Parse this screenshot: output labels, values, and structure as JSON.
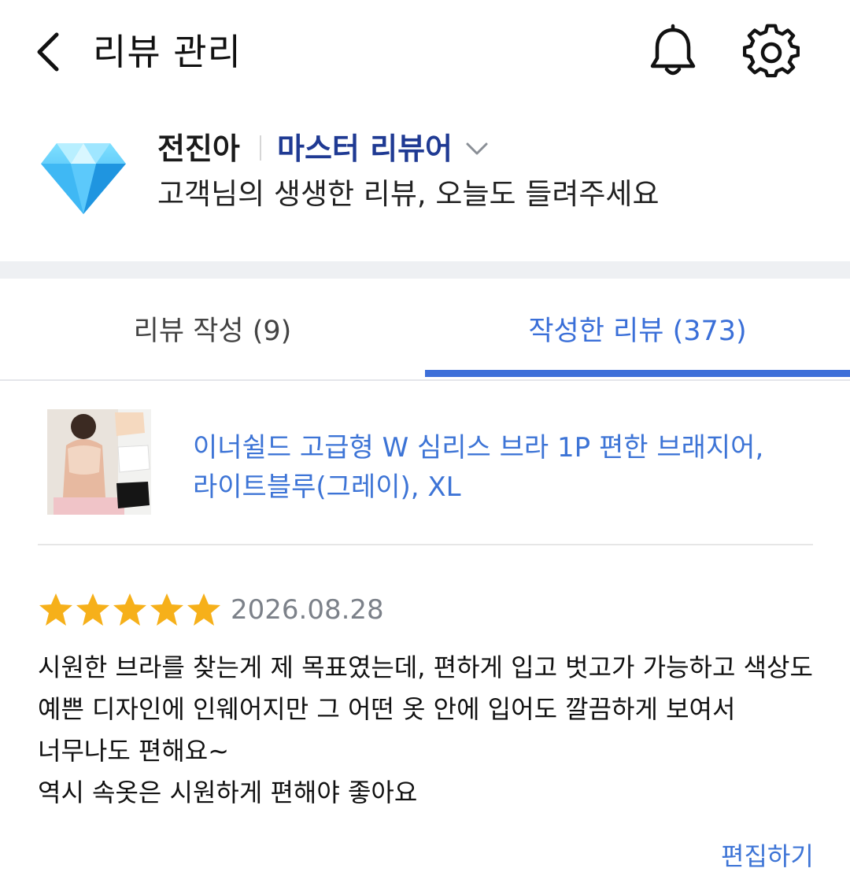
{
  "header": {
    "title": "리뷰 관리",
    "back_icon": "chevron-left-icon",
    "bell_icon": "bell-icon",
    "gear_icon": "gear-icon"
  },
  "profile": {
    "badge_icon": "diamond-icon",
    "name": "전진아",
    "grade": "마스터 리뷰어",
    "subtitle": "고객님의 생생한 리뷰, 오늘도 들려주세요"
  },
  "tabs": [
    {
      "label": "리뷰 작성 (9)",
      "active": false
    },
    {
      "label": "작성한 리뷰 (373)",
      "active": true
    }
  ],
  "product": {
    "name_line1": "이너쉴드 고급형 W 심리스 브라 1P 편한 브래지어,",
    "name_line2": "라이트블루(그레이), XL"
  },
  "review": {
    "rating": 5,
    "rating_max": 5,
    "date": "2026.08.28",
    "lines": [
      "시원한 브라를 찾는게 제 목표였는데, 편하게 입고 벗고가 가능하고 색상도",
      "예쁜 디자인에 인웨어지만 그 어떤 옷 안에 입어도 깔끔하게 보여서",
      "너무나도 편해요~",
      "역시 속옷은 시원하게 편해야 좋아요"
    ],
    "edit_label": "편집하기"
  },
  "colors": {
    "accent": "#3d6fd9",
    "grade": "#1f3a93",
    "star": "#f6b01a",
    "date": "#7c8189"
  }
}
